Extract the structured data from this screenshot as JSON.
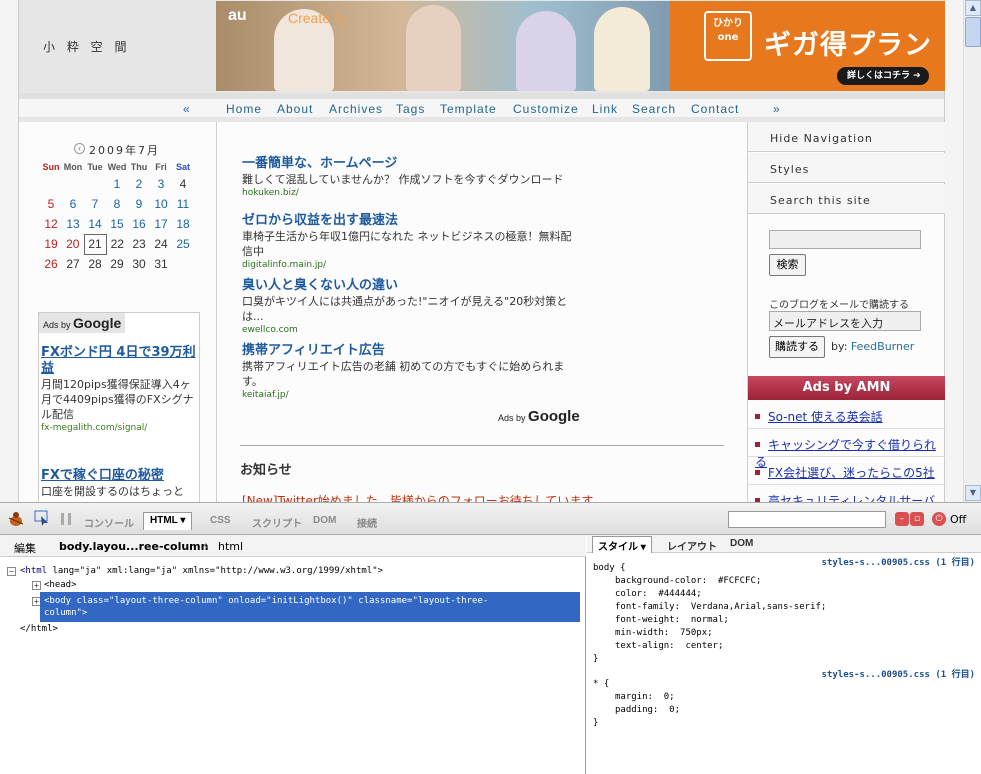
{
  "site": {
    "title": "小 粋 空 間",
    "banner": {
      "brand": "au",
      "create": "Create fu",
      "hikari": "ひかり one",
      "headline": "ギガ得プラン",
      "cta": "詳しくはコチラ ➔"
    }
  },
  "nav": {
    "prev": "«",
    "next": "»",
    "items": [
      "Home",
      "About",
      "Archives",
      "Tags",
      "Template",
      "Customize",
      "Link",
      "Search",
      "Contact"
    ]
  },
  "calendar": {
    "title": "2009年7月",
    "prev": "‹",
    "weekdays": [
      "Sun",
      "Mon",
      "Tue",
      "Wed",
      "Thu",
      "Fri",
      "Sat"
    ],
    "weeks": [
      [
        "",
        "",
        "",
        "1",
        "2",
        "3",
        "4"
      ],
      [
        "5",
        "6",
        "7",
        "8",
        "9",
        "10",
        "11"
      ],
      [
        "12",
        "13",
        "14",
        "15",
        "16",
        "17",
        "18"
      ],
      [
        "19",
        "20",
        "21",
        "22",
        "23",
        "24",
        "25"
      ],
      [
        "26",
        "27",
        "28",
        "29",
        "30",
        "31",
        ""
      ]
    ]
  },
  "left_ads": {
    "badge_prefix": "Ads by",
    "badge_brand": "Google",
    "items": [
      {
        "title": "FXボンド円 4日で39万利益",
        "text": "月間120pips獲得保証導入4ヶ月で4409pips獲得のFXシグナル配信",
        "url": "fx-megalith.com/signal/"
      },
      {
        "title": "FXで稼ぐ口座の秘密",
        "text": "口座を開設するのはちょっと",
        "url": ""
      }
    ]
  },
  "center_ads": {
    "items": [
      {
        "title": "一番簡単な、ホームページ",
        "text": "難しくて混乱していませんか？ 作成ソフトを今すぐダウンロード",
        "url": "hokuken.biz/"
      },
      {
        "title": "ゼロから収益を出す最速法",
        "text": "車椅子生活から年収1億円になれた ネットビジネスの極意！無料配信中",
        "url": "digitalinfo.main.jp/"
      },
      {
        "title": "臭い人と臭くない人の違い",
        "text": "口臭がキツイ人には共通点があった!\"ニオイが見える\"20秒対策とは...",
        "url": "ewellco.com"
      },
      {
        "title": "携帯アフィリエイト広告",
        "text": "携帯アフィリエイト広告の老舗 初めての方でもすぐに始められます。",
        "url": "keitaiaf.jp/"
      }
    ],
    "ads_by_prefix": "Ads by",
    "ads_by_brand": "Google",
    "notice_title": "お知らせ",
    "notice_text": "[New]Twitter始めました。皆様からのフォローお待ちしています。"
  },
  "sidebar": {
    "tabs": [
      "Hide Navigation",
      "Styles",
      "Search this site"
    ],
    "search_button": "検索",
    "subscribe_label": "このブログをメールで購読する",
    "subscribe_placeholder": "メールアドレスを入力",
    "subscribe_button": "購読する",
    "by_label": "by:",
    "by_service": "FeedBurner",
    "amn_title": "Ads by AMN",
    "amn_items": [
      "So-net 使える英会話",
      "キャッシングで今すぐ借りられる",
      "FX会社選び、迷ったらこの5社",
      "高セキュリティレンタルサーバー"
    ]
  },
  "firebug": {
    "tabs": [
      "コンソール",
      "HTML ▾",
      "CSS",
      "スクリプト",
      "DOM",
      "接続"
    ],
    "off_label": "Off",
    "breadcrumb": {
      "edit": "編集",
      "current": "body.layou...ree-column",
      "parent": "html"
    },
    "html_lines": {
      "line1_tag": "<html",
      "line1_attrs": " lang=\"ja\" xml:lang=\"ja\" xmlns=\"http://www.w3.org/1999/xhtml\">",
      "line2": "<head>",
      "line3a": "<body class=\"layout-three-column\" onload=\"initLightbox()\" classname=\"layout-three-",
      "line3b": "column\">",
      "line4": "</html>"
    },
    "right_tabs": [
      "スタイル ▾",
      "レイアウト",
      "DOM"
    ],
    "css_rules": [
      {
        "file": "styles-s...00905.css (1 行目)",
        "selector": "body {",
        "props": [
          "background-color:  #FCFCFC;",
          "color:  #444444;",
          "font-family:  Verdana,Arial,sans-serif;",
          "font-weight:  normal;",
          "min-width:  750px;",
          "text-align:  center;"
        ],
        "close": "}"
      },
      {
        "file": "styles-s...00905.css (1 行目)",
        "selector": "* {",
        "props": [
          "margin:  0;",
          "padding:  0;"
        ],
        "close": "}"
      }
    ]
  },
  "colors": {
    "link": "#1f5a9e",
    "accent": "#9c2239",
    "selection": "#3268c4",
    "banner": "#e8781e"
  }
}
